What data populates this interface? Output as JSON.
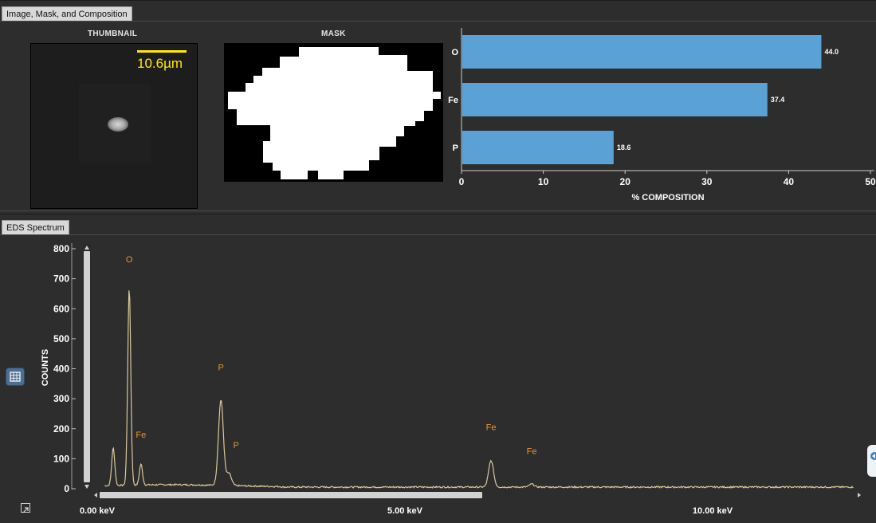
{
  "top_panel": {
    "tab": "Image, Mask, and Composition",
    "thumbnail_heading": "THUMBNAIL",
    "scale_label": "10.6µm",
    "mask_heading": "MASK"
  },
  "chart_data": [
    {
      "type": "bar",
      "orientation": "horizontal",
      "categories": [
        "O",
        "Fe",
        "P"
      ],
      "values": [
        44.0,
        37.4,
        18.6
      ],
      "value_labels": [
        "44.0",
        "37.4",
        "18.6"
      ],
      "xlabel": "% COMPOSITION",
      "xlim": [
        0,
        50
      ],
      "xticks": [
        "0",
        "10",
        "20",
        "30",
        "40",
        "50"
      ],
      "bar_color": "#5aa2d6"
    },
    {
      "type": "line",
      "xlabel": "",
      "ylabel": "COUNTS",
      "xticks": [
        "0.00 keV",
        "5.00 keV",
        "10.00 keV"
      ],
      "yticks": [
        "0",
        "100",
        "200",
        "300",
        "400",
        "500",
        "600",
        "700",
        "800"
      ],
      "xlim": [
        0,
        12.5
      ],
      "ylim": [
        0,
        800
      ],
      "line_color": "#d9c89a",
      "peaks": [
        {
          "keV": 0.26,
          "counts": 125
        },
        {
          "keV": 0.52,
          "counts": 655
        },
        {
          "keV": 0.71,
          "counts": 70
        },
        {
          "keV": 2.01,
          "counts": 285
        },
        {
          "keV": 2.14,
          "counts": 40
        },
        {
          "keV": 6.4,
          "counts": 88
        },
        {
          "keV": 7.06,
          "counts": 10
        }
      ],
      "peak_labels": [
        {
          "text": "O",
          "keV": 0.52,
          "counts": 755
        },
        {
          "text": "Fe",
          "keV": 0.71,
          "counts": 170
        },
        {
          "text": "P",
          "keV": 2.01,
          "counts": 395
        },
        {
          "text": "P",
          "keV": 2.14,
          "counts": 135
        },
        {
          "text": "Fe",
          "keV": 6.4,
          "counts": 195
        },
        {
          "text": "Fe",
          "keV": 7.06,
          "counts": 115
        }
      ]
    }
  ],
  "bottom_panel": {
    "tab": "EDS Spectrum"
  },
  "icons": {
    "table_toggle": "grid-icon",
    "expand": "expand-icon"
  }
}
